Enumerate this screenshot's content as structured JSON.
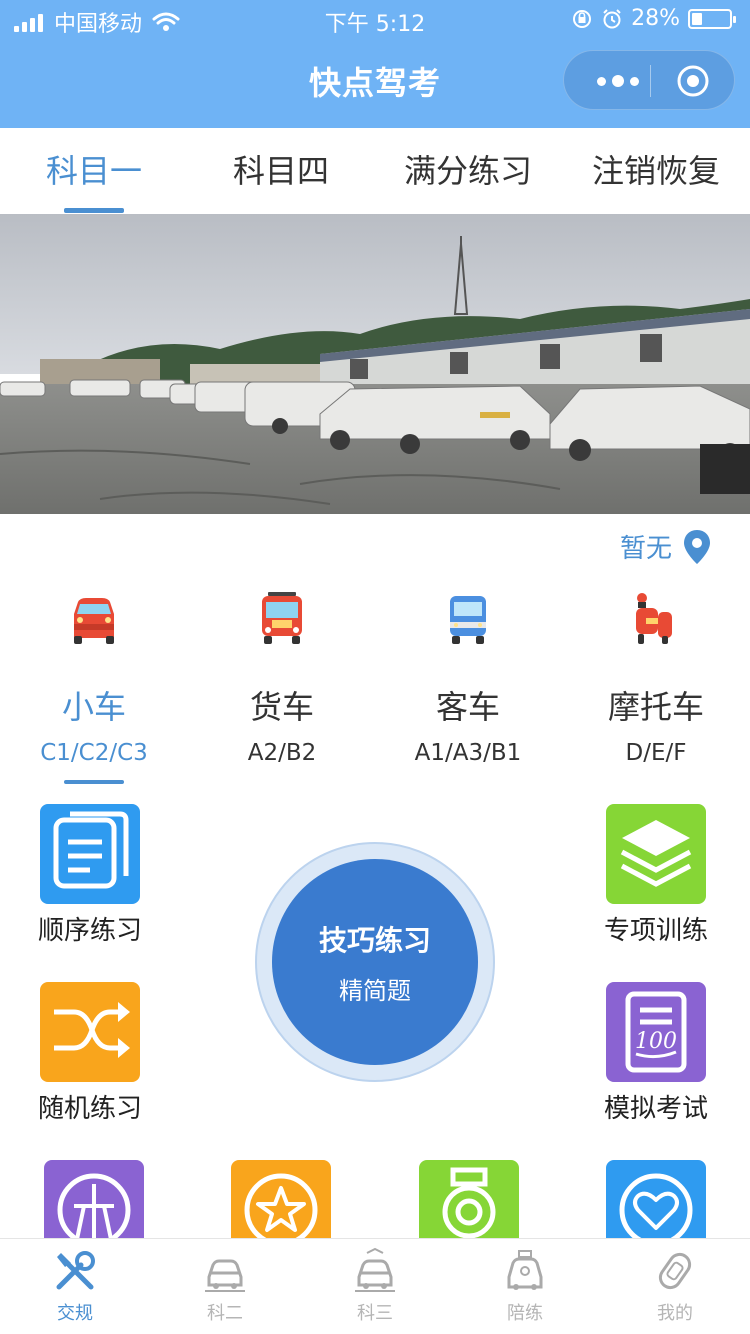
{
  "status_bar": {
    "carrier": "中国移动",
    "time": "下午 5:12",
    "battery_text": "28%",
    "battery_level": 0.28,
    "icons": [
      "signal-icon",
      "wifi-icon",
      "orientation-lock-icon",
      "alarm-icon",
      "battery-icon"
    ]
  },
  "title_bar": {
    "title": "快点驾考",
    "icons": [
      "more-dots-icon",
      "close-target-icon"
    ]
  },
  "tabs": [
    {
      "label": "科目一",
      "active": true
    },
    {
      "label": "科目四",
      "active": false
    },
    {
      "label": "满分练习",
      "active": false
    },
    {
      "label": "注销恢复",
      "active": false
    }
  ],
  "location": {
    "text": "暂无",
    "icon": "location-pin-icon"
  },
  "vehicles": [
    {
      "name": "小车",
      "code": "C1/C2/C3",
      "icon": "car-icon",
      "active": true
    },
    {
      "name": "货车",
      "code": "A2/B2",
      "icon": "bus-icon",
      "active": false
    },
    {
      "name": "客车",
      "code": "A1/A3/B1",
      "icon": "van-icon",
      "active": false
    },
    {
      "name": "摩托车",
      "code": "D/E/F",
      "icon": "motorcycle-icon",
      "active": false
    }
  ],
  "features": [
    {
      "label": "顺序练习",
      "icon": "document-list-icon",
      "color": "#2f9bf0"
    },
    {
      "label": "专项训练",
      "icon": "layers-icon",
      "color": "#86d636"
    },
    {
      "label": "随机练习",
      "icon": "shuffle-icon",
      "color": "#f9a51c"
    },
    {
      "label": "模拟考试",
      "icon": "exam-100-icon",
      "color": "#8a63d2"
    }
  ],
  "center_button": {
    "title": "技巧练习",
    "subtitle": "精简题",
    "color": "#3a7bcf"
  },
  "bottom_row_icons": [
    {
      "icon": "road-sign-icon",
      "color": "#8a63d2"
    },
    {
      "icon": "star-icon",
      "color": "#f9a51c"
    },
    {
      "icon": "medal-icon",
      "color": "#86d636"
    },
    {
      "icon": "heart-icon",
      "color": "#2f9bf0"
    }
  ],
  "bottom_tabs": [
    {
      "label": "交规",
      "icon": "tools-icon",
      "active": true
    },
    {
      "label": "科二",
      "icon": "car-outline-icon",
      "active": false
    },
    {
      "label": "科三",
      "icon": "car-road-icon",
      "active": false
    },
    {
      "label": "陪练",
      "icon": "taxi-icon",
      "active": false
    },
    {
      "label": "我的",
      "icon": "car-key-icon",
      "active": false
    }
  ],
  "colors": {
    "header": "#6fb3f5",
    "accent": "#4a8fd1",
    "inactive_tab": "#b5b5b5"
  }
}
